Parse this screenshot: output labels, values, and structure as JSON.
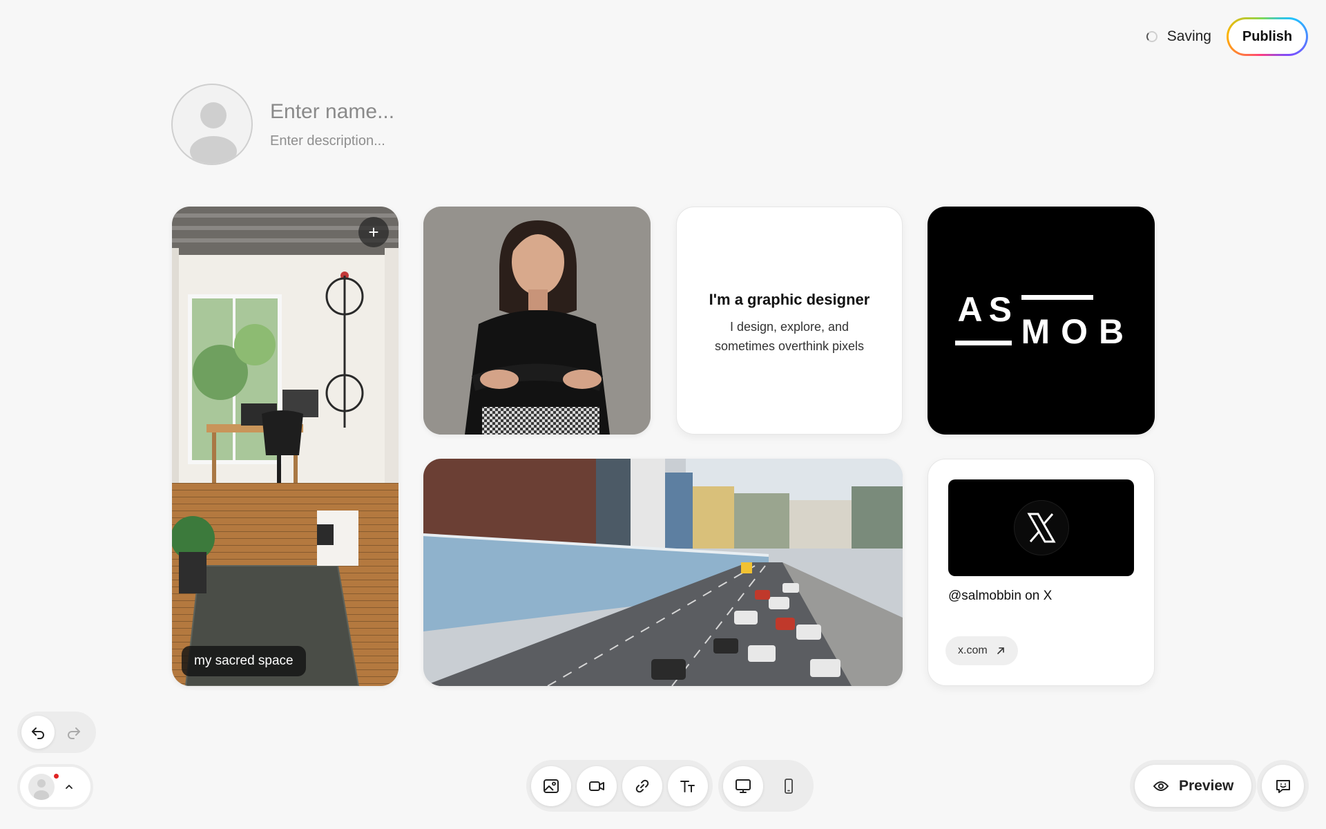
{
  "header": {
    "saving_label": "Saving",
    "publish_label": "Publish"
  },
  "profile": {
    "name_placeholder": "Enter name...",
    "description_placeholder": "Enter description..."
  },
  "cards": {
    "room": {
      "caption": "my sacred space",
      "add_symbol": "+"
    },
    "text": {
      "title": "I'm a graphic designer",
      "body_line1": "I design, explore, and",
      "body_line2": "sometimes overthink pixels"
    },
    "logo": {
      "line1": "AS",
      "line2": "MOB"
    },
    "x": {
      "handle": "@salmobbin on X",
      "link_label": "x.com"
    }
  },
  "toolbar": {
    "icons": [
      "image-icon",
      "video-icon",
      "link-icon",
      "text-icon",
      "desktop-icon",
      "mobile-icon"
    ]
  },
  "footer": {
    "preview_label": "Preview"
  },
  "colors": {
    "background": "#f7f7f7",
    "accent_notification": "#e02424"
  }
}
